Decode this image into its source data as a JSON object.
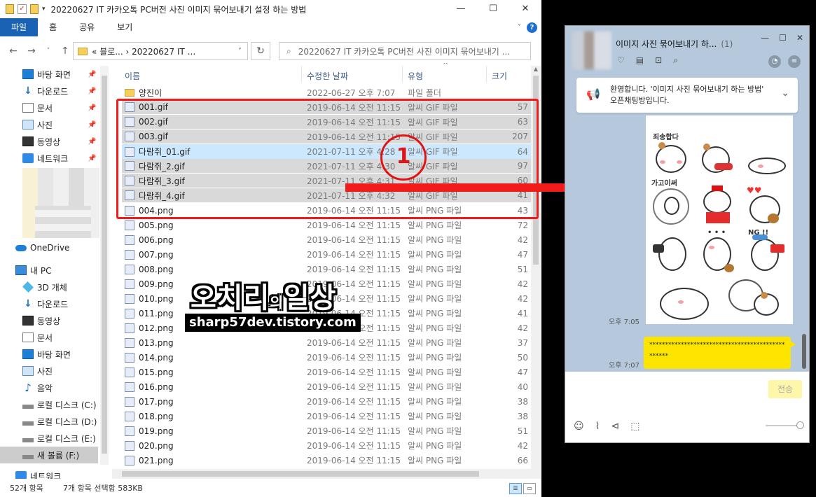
{
  "explorer": {
    "window_title": "20220627 IT 카카오톡 PC버전 사진 이미지 묶어보내기 설정 하는 방법",
    "controls": {
      "minimize": "—",
      "maximize": "☐",
      "close": "✕"
    },
    "ribbon": {
      "tabs": [
        "파일",
        "홈",
        "공유",
        "보기"
      ],
      "help": "?"
    },
    "address": {
      "path": "« 블로... › 20220627 IT ...",
      "search_placeholder": "20220627 IT 카카오톡 PC버전 사진 이미지 묶어보내기 ..."
    },
    "nav": [
      {
        "label": "바탕 화면",
        "icon": "desktop-icon",
        "pinned": true
      },
      {
        "label": "다운로드",
        "icon": "download-icon",
        "pinned": true
      },
      {
        "label": "문서",
        "icon": "document-icon",
        "pinned": true
      },
      {
        "label": "사진",
        "icon": "picture-icon",
        "pinned": true
      },
      {
        "label": "동영상",
        "icon": "video-icon",
        "pinned": true
      },
      {
        "label": "네트워크",
        "icon": "network-icon",
        "pinned": true
      },
      {
        "label": "OneDrive",
        "icon": "cloud-icon"
      },
      {
        "label": "내 PC",
        "icon": "pc-icon"
      },
      {
        "label": "3D 개체",
        "icon": "cube-icon"
      },
      {
        "label": "다운로드",
        "icon": "download-icon"
      },
      {
        "label": "동영상",
        "icon": "video-icon"
      },
      {
        "label": "문서",
        "icon": "document-icon"
      },
      {
        "label": "바탕 화면",
        "icon": "desktop-icon"
      },
      {
        "label": "사진",
        "icon": "picture-icon"
      },
      {
        "label": "음악",
        "icon": "music-icon"
      },
      {
        "label": "로컬 디스크 (C:)",
        "icon": "drive-icon"
      },
      {
        "label": "로컬 디스크 (D:)",
        "icon": "drive-icon"
      },
      {
        "label": "로컬 디스크 (E:)",
        "icon": "drive-icon"
      },
      {
        "label": "새 볼륨 (F:)",
        "icon": "drive-icon",
        "selected": true
      },
      {
        "label": "네트워크",
        "icon": "network-icon"
      }
    ],
    "columns": {
      "name": "이름",
      "date": "수정한 날짜",
      "type": "유형",
      "size": "크기"
    },
    "files": [
      {
        "name": "양진이",
        "date": "2022-06-27 오후 7:07",
        "type": "파일 폴더",
        "size": "",
        "kind": "folder"
      },
      {
        "name": "001.gif",
        "date": "2019-06-14 오전 11:15",
        "type": "알씨 GIF 파일",
        "size": "57",
        "selected": true
      },
      {
        "name": "002.gif",
        "date": "2019-06-14 오전 11:15",
        "type": "알씨 GIF 파일",
        "size": "63",
        "selected": true
      },
      {
        "name": "003.gif",
        "date": "2019-06-14 오전 11:15",
        "type": "알씨 GIF 파일",
        "size": "207",
        "selected": true
      },
      {
        "name": "다람쥐_01.gif",
        "date": "2021-07-11 오후 4:28",
        "type": "알씨 GIF 파일",
        "size": "64",
        "selected": true,
        "focused": true
      },
      {
        "name": "다람쥐_2.gif",
        "date": "2021-07-11 오후 4:30",
        "type": "알씨 GIF 파일",
        "size": "97",
        "selected": true
      },
      {
        "name": "다람쥐_3.gif",
        "date": "2021-07-11 오후 4:31",
        "type": "알씨 GIF 파일",
        "size": "60",
        "selected": true
      },
      {
        "name": "다람쥐_4.gif",
        "date": "2021-07-11 오후 4:32",
        "type": "알씨 GIF 파일",
        "size": "41",
        "selected": true
      },
      {
        "name": "004.png",
        "date": "2019-06-14 오전 11:15",
        "type": "알씨 PNG 파일",
        "size": "43"
      },
      {
        "name": "005.png",
        "date": "2019-06-14 오전 11:15",
        "type": "알씨 PNG 파일",
        "size": "72"
      },
      {
        "name": "006.png",
        "date": "2019-06-14 오전 11:15",
        "type": "알씨 PNG 파일",
        "size": "42"
      },
      {
        "name": "007.png",
        "date": "2019-06-14 오전 11:15",
        "type": "알씨 PNG 파일",
        "size": "47"
      },
      {
        "name": "008.png",
        "date": "2019-06-14 오전 11:15",
        "type": "알씨 PNG 파일",
        "size": "51"
      },
      {
        "name": "009.png",
        "date": "2019-06-14 오전 11:15",
        "type": "알씨 PNG 파일",
        "size": "42"
      },
      {
        "name": "010.png",
        "date": "2019-06-14 오전 11:15",
        "type": "알씨 PNG 파일",
        "size": "42"
      },
      {
        "name": "011.png",
        "date": "2019-06-14 오전 11:15",
        "type": "알씨 PNG 파일",
        "size": "41"
      },
      {
        "name": "012.png",
        "date": "2019-06-14 오전 11:15",
        "type": "알씨 PNG 파일",
        "size": "42"
      },
      {
        "name": "013.png",
        "date": "2019-06-14 오전 11:15",
        "type": "알씨 PNG 파일",
        "size": "37"
      },
      {
        "name": "014.png",
        "date": "2019-06-14 오전 11:15",
        "type": "알씨 PNG 파일",
        "size": "50"
      },
      {
        "name": "015.png",
        "date": "2019-06-14 오전 11:15",
        "type": "알씨 PNG 파일",
        "size": "47"
      },
      {
        "name": "016.png",
        "date": "2019-06-14 오전 11:15",
        "type": "알씨 PNG 파일",
        "size": "40"
      },
      {
        "name": "017.png",
        "date": "2019-06-14 오전 11:15",
        "type": "알씨 PNG 파일",
        "size": "38"
      },
      {
        "name": "018.png",
        "date": "2019-06-14 오전 11:15",
        "type": "알씨 PNG 파일",
        "size": "38"
      },
      {
        "name": "019.png",
        "date": "2019-06-14 오전 11:15",
        "type": "알씨 PNG 파일",
        "size": "51"
      },
      {
        "name": "020.png",
        "date": "2019-06-14 오전 11:15",
        "type": "알씨 PNG 파일",
        "size": "42"
      },
      {
        "name": "021.png",
        "date": "2019-06-14 오전 11:15",
        "type": "알씨 PNG 파일",
        "size": "66"
      }
    ],
    "status": {
      "count": "52개 항목",
      "selection": "7개 항목 선택함 583KB"
    }
  },
  "annotation": {
    "step": "1",
    "watermark": "오치리",
    "watermark_mid": "의",
    "watermark_end": "일상",
    "watermark_url": "sharp57dev.tistory.com",
    "color": "#f21b1b"
  },
  "kakao": {
    "title": "이미지 사진 묶어보내기 하...",
    "member_count": "(1)",
    "notice": "환영합니다. '이미지 사진 묶어보내기 하는 방법' 오픈채팅방입니다.",
    "sticker_texts": [
      "죄송합다",
      "가고이써",
      "NG !!",
      "• • •"
    ],
    "time1": "오후 7:05",
    "time2": "오후 7:07",
    "message": "*************************************************",
    "send": "전송",
    "accent": "#fee500"
  }
}
